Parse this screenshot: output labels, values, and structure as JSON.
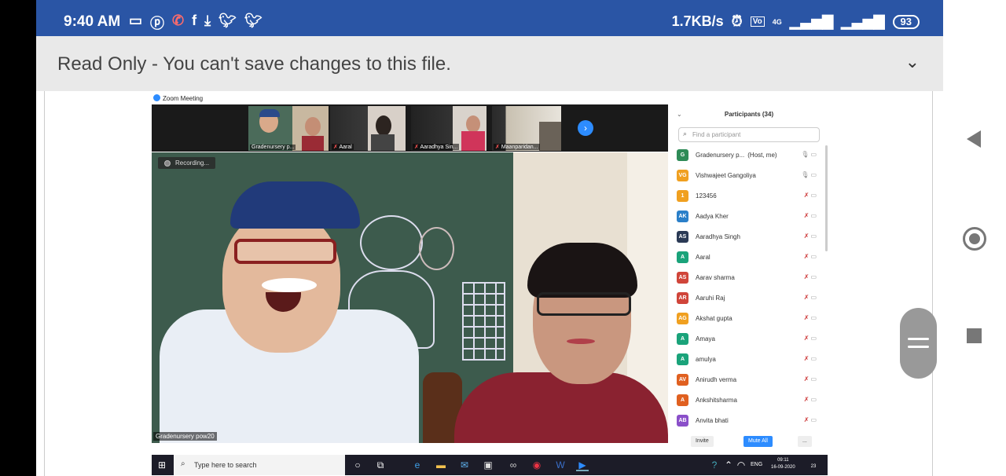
{
  "status_bar": {
    "time": "9:40 AM",
    "net_speed": "1.7KB/s",
    "network_label": "4G",
    "battery": "93",
    "icons": [
      "video-icon",
      "pinterest-icon",
      "missed-call-icon",
      "facebook-icon",
      "download-icon",
      "twitter-icon",
      "twitter-icon",
      "alarm-icon",
      "volte-icon",
      "signal-icon",
      "signal-icon",
      "battery-icon"
    ]
  },
  "banner": {
    "text": "Read Only - You can't save changes to this file."
  },
  "zoom": {
    "title": "Zoom Meeting",
    "thumbnails": [
      {
        "label": "Gradenursery p..."
      },
      {
        "label": "Aaral"
      },
      {
        "label": "Aaradhya Sin..."
      },
      {
        "label": "Maanparidan..."
      }
    ],
    "recording_label": "Recording...",
    "active_speaker_label": "Gradenursery pow20",
    "participants_header": "Participants (34)",
    "search_placeholder": "Find a participant",
    "participants": [
      {
        "initials": "G",
        "name": "Gradenursery p...",
        "suffix": "(Host, me)",
        "color": "#2e8b57"
      },
      {
        "initials": "VG",
        "name": "Vishwajeet Gangoliya",
        "suffix": "",
        "color": "#f0a020"
      },
      {
        "initials": "1",
        "name": "123456",
        "suffix": "",
        "color": "#f0a020"
      },
      {
        "initials": "AK",
        "name": "Aadya Kher",
        "suffix": "",
        "color": "#2a7fc9"
      },
      {
        "initials": "AS",
        "name": "Aaradhya Singh",
        "suffix": "",
        "color": "#2b3a55"
      },
      {
        "initials": "A",
        "name": "Aaral",
        "suffix": "",
        "color": "#1aa37a"
      },
      {
        "initials": "AS",
        "name": "Aarav sharma",
        "suffix": "",
        "color": "#d0453a"
      },
      {
        "initials": "AR",
        "name": "Aaruhi Raj",
        "suffix": "",
        "color": "#d0453a"
      },
      {
        "initials": "AG",
        "name": "Akshat gupta",
        "suffix": "",
        "color": "#f0a020"
      },
      {
        "initials": "A",
        "name": "Amaya",
        "suffix": "",
        "color": "#1aa37a"
      },
      {
        "initials": "A",
        "name": "amulya",
        "suffix": "",
        "color": "#1aa37a"
      },
      {
        "initials": "AV",
        "name": "Anirudh verma",
        "suffix": "",
        "color": "#e06020"
      },
      {
        "initials": "A",
        "name": "Ankshitsharma",
        "suffix": "",
        "color": "#e06020"
      },
      {
        "initials": "AB",
        "name": "Anvita bhati",
        "suffix": "",
        "color": "#8a4fc9"
      }
    ],
    "footer": {
      "invite": "Invite",
      "mute_all": "Mute All",
      "more": "..."
    }
  },
  "taskbar": {
    "search_placeholder": "Type here to search",
    "language": "ENG",
    "time": "09:11",
    "date": "16-09-2020",
    "notification_count": "23"
  }
}
